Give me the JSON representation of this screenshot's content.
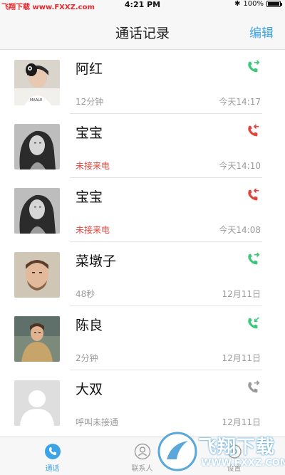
{
  "status_bar": {
    "watermark": "飞翔下载 www.FXXZ.com",
    "time": "4:21 PM",
    "bluetooth": "✱",
    "battery": "100%",
    "battery_level": 1.0
  },
  "nav": {
    "title": "通话记录",
    "edit": "编辑"
  },
  "calls": [
    {
      "name": "阿红",
      "detail": "12分钟",
      "time": "今天14:17",
      "status": "outgoing",
      "icon": "phone-outgoing-icon",
      "color": "#3cc77a"
    },
    {
      "name": "宝宝",
      "detail": "未接来电",
      "time": "今天14:10",
      "status": "missed",
      "icon": "phone-missed-icon",
      "color": "#e2453c"
    },
    {
      "name": "宝宝",
      "detail": "未接来电",
      "time": "今天14:08",
      "status": "missed",
      "icon": "phone-missed-icon",
      "color": "#e2453c"
    },
    {
      "name": "菜墩子",
      "detail": "48秒",
      "time": "12月11日",
      "status": "outgoing",
      "icon": "phone-outgoing-icon",
      "color": "#3cc77a"
    },
    {
      "name": "陈良",
      "detail": "2分钟",
      "time": "12月11日",
      "status": "incoming",
      "icon": "phone-incoming-icon",
      "color": "#3cc77a"
    },
    {
      "name": "大双",
      "detail": "呼叫未接通",
      "time": "12月11日",
      "status": "unanswered",
      "icon": "phone-outgoing-icon",
      "color": "#9a9a9a"
    }
  ],
  "tabs": [
    {
      "label": "通话",
      "icon": "phone-icon",
      "active": true
    },
    {
      "label": "联系人",
      "icon": "contacts-icon",
      "active": false
    },
    {
      "label": "设置",
      "icon": "settings-icon",
      "active": false
    }
  ],
  "logo_watermark": {
    "big": "飞翔下载",
    "small": "WWW.FXXZ.COM"
  },
  "colors": {
    "accent": "#3ba3e6",
    "missed": "#e2453c",
    "answered": "#3cc77a"
  }
}
